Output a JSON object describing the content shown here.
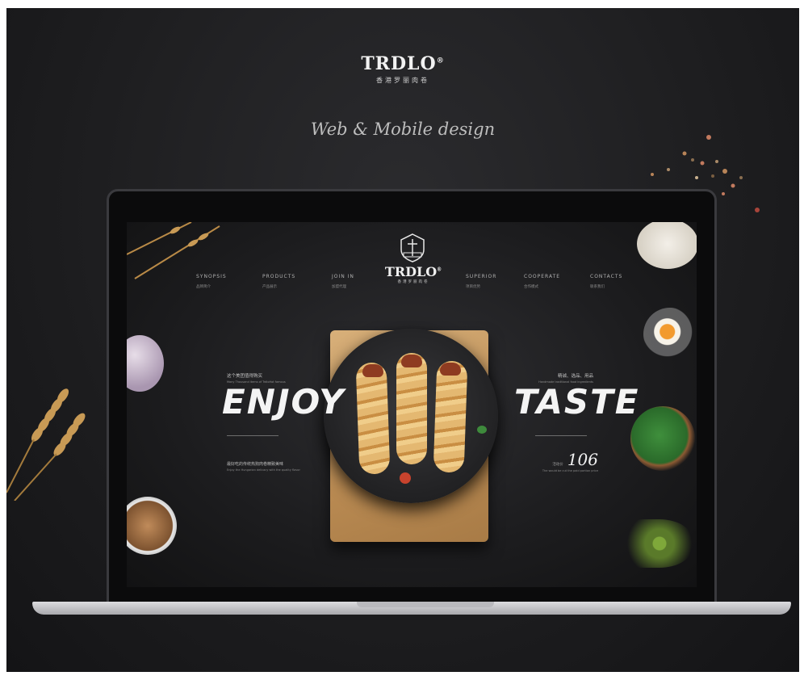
{
  "brand": {
    "title": "TRDLO",
    "registered": "®",
    "subtitle": "香港罗丽肉卷"
  },
  "tagline": "Web & Mobile design",
  "site": {
    "nav_left": [
      {
        "en": "SYNOPSIS",
        "cn": "品牌简介"
      },
      {
        "en": "PRODUCTS",
        "cn": "产品展示"
      },
      {
        "en": "JOIN IN",
        "cn": "加盟代理"
      }
    ],
    "nav_right": [
      {
        "en": "SUPERIOR",
        "cn": "项目优势"
      },
      {
        "en": "COOPERATE",
        "cn": "合作模式"
      },
      {
        "en": "CONTACTS",
        "cn": "联系我们"
      }
    ],
    "logo_title": "TRDLO",
    "logo_registered": "®",
    "logo_subtitle": "香港罗丽肉卷",
    "hero": {
      "left_cn": "这个美团值得购买",
      "left_en": "Many Thousand items of TrdloHot famous",
      "headline_left": "ENJOY",
      "headline_right": "TASTE",
      "right_cn": "精诚、选品、用品",
      "right_en": "Handmade traditional food ingredients",
      "foot_cn": "最好吃的传统热狗肉卷精致美味",
      "foot_en": "Enjoy the Hungarian delicacy with the quality flavor",
      "price_label": "活动价",
      "price": "106",
      "price_note": "The would be cut the paid portion price"
    }
  },
  "colors": {
    "background": "#1e1e20",
    "text": "#f4f4f4",
    "wood": "#c4955c"
  }
}
